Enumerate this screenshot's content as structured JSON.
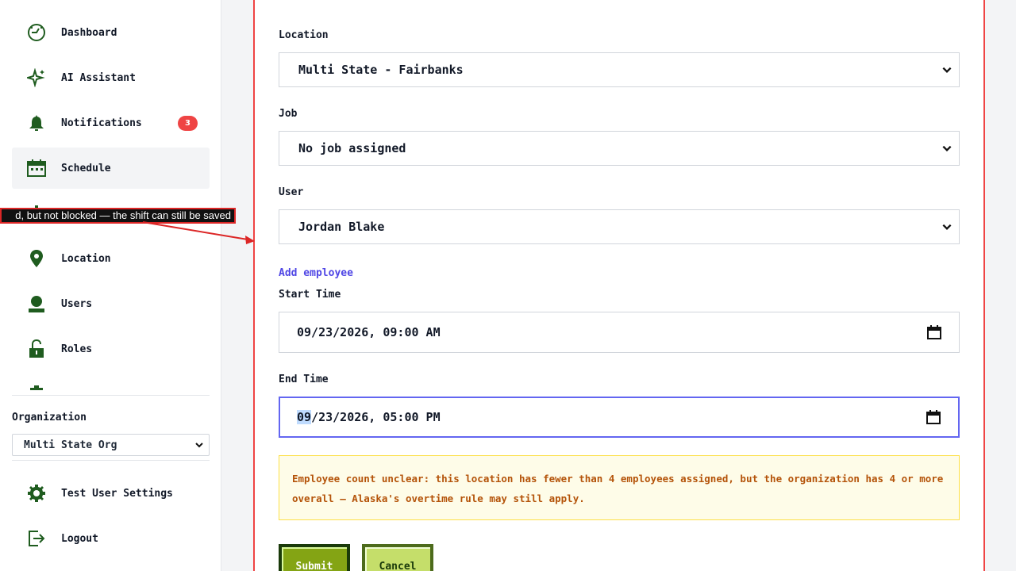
{
  "sidebar": {
    "items": [
      {
        "label": "Dashboard",
        "icon": "dashboard-icon"
      },
      {
        "label": "AI Assistant",
        "icon": "sparkle-icon"
      },
      {
        "label": "Notifications",
        "icon": "bell-icon",
        "badge": "3"
      },
      {
        "label": "Schedule",
        "icon": "calendar-icon",
        "active": true
      },
      {
        "label": "",
        "icon": "chart-icon"
      },
      {
        "label": "Location",
        "icon": "map-pin-icon"
      },
      {
        "label": "Users",
        "icon": "user-icon"
      },
      {
        "label": "Roles",
        "icon": "unlock-icon"
      },
      {
        "label": "",
        "icon": "more-icon"
      }
    ],
    "organization": {
      "label": "Organization",
      "selected": "Multi State Org"
    },
    "footer": [
      {
        "label": "Test User Settings",
        "icon": "gear-icon"
      },
      {
        "label": "Logout",
        "icon": "logout-icon"
      }
    ]
  },
  "tooltip": {
    "text": "d, but not blocked — the shift can still be saved"
  },
  "form": {
    "location": {
      "label": "Location",
      "value": "Multi State - Fairbanks"
    },
    "job": {
      "label": "Job",
      "value": "No job assigned"
    },
    "user": {
      "label": "User",
      "value": "Jordan Blake"
    },
    "add_employee": "Add employee",
    "start_time": {
      "label": "Start Time",
      "value": "09/23/2026, 09:00 AM"
    },
    "end_time": {
      "label": "End Time",
      "month": "09",
      "rest": "/23/2026, 05:00 PM"
    },
    "warning": "Employee count unclear: this location has fewer than 4 employees assigned, but the organization has 4 or more overall — Alaska's overtime rule may still apply.",
    "submit_label": "Submit",
    "cancel_label": "Cancel"
  },
  "colors": {
    "accent": "#1f5c1f",
    "badge": "#ef4444",
    "link": "#4f46e5",
    "focus": "#6366f1",
    "warning_text": "#b45309"
  }
}
